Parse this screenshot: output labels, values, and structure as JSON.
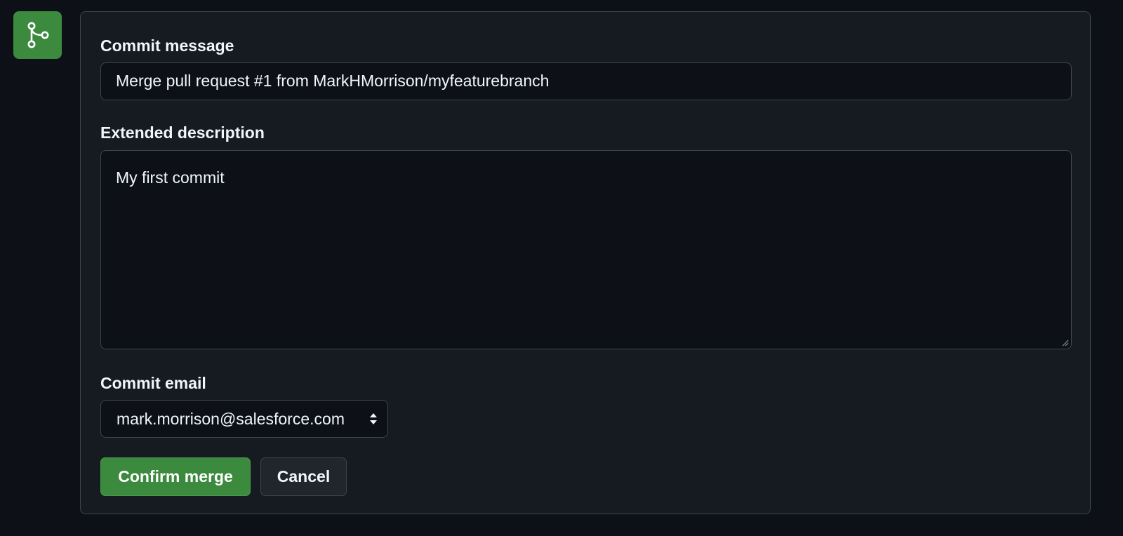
{
  "form": {
    "commit_message_label": "Commit message",
    "commit_message_value": "Merge pull request #1 from MarkHMorrison/myfeaturebranch",
    "description_label": "Extended description",
    "description_value": "My first commit",
    "email_label": "Commit email",
    "email_value": "mark.morrison@salesforce.com"
  },
  "actions": {
    "confirm_label": "Confirm merge",
    "cancel_label": "Cancel"
  },
  "icons": {
    "badge": "git-merge-icon",
    "select": "up-down-arrows-icon",
    "grip": "resize-grip-icon"
  },
  "colors": {
    "background": "#0d1117",
    "panel": "#161b22",
    "accent_green": "#3b8a3e",
    "border": "#3d444d"
  }
}
